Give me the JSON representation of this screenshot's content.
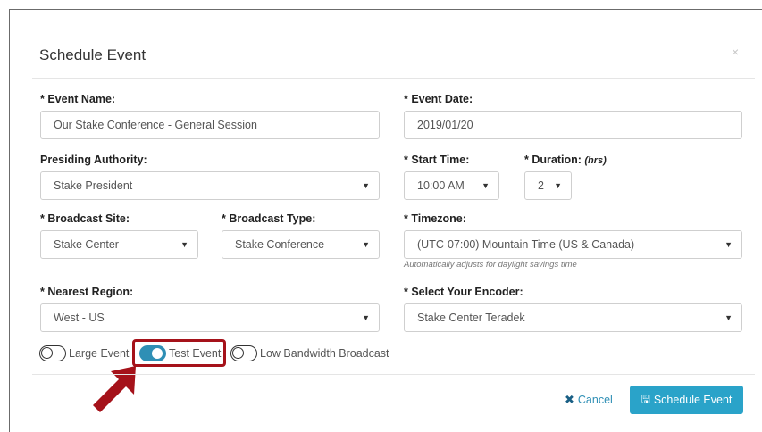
{
  "modal": {
    "title": "Schedule Event",
    "close_icon": "×"
  },
  "form": {
    "event_name": {
      "label": "* Event Name:",
      "value": "Our Stake Conference - General Session"
    },
    "event_date": {
      "label": "* Event Date:",
      "value": "2019/01/20"
    },
    "presiding_authority": {
      "label": "Presiding Authority:",
      "value": "Stake President"
    },
    "start_time": {
      "label": "* Start Time:",
      "value": "10:00 AM"
    },
    "duration": {
      "label": "* Duration:",
      "unit": "(hrs)",
      "value": "2"
    },
    "broadcast_site": {
      "label": "* Broadcast Site:",
      "value": "Stake Center"
    },
    "broadcast_type": {
      "label": "* Broadcast Type:",
      "value": "Stake Conference"
    },
    "timezone": {
      "label": "* Timezone:",
      "value": "(UTC-07:00) Mountain Time (US & Canada)",
      "help": "Automatically adjusts for daylight savings time"
    },
    "nearest_region": {
      "label": "* Nearest Region:",
      "value": "West - US"
    },
    "encoder": {
      "label": "* Select Your Encoder:",
      "value": "Stake Center Teradek"
    }
  },
  "toggles": {
    "large_event": {
      "label": "Large Event",
      "on": false
    },
    "test_event": {
      "label": "Test Event",
      "on": true
    },
    "low_bandwidth": {
      "label": "Low Bandwidth Broadcast",
      "on": false
    }
  },
  "footer": {
    "cancel_label": "Cancel",
    "schedule_label": "Schedule Event"
  },
  "colors": {
    "accent": "#2aa3c9",
    "toggle_on": "#2f8fb5",
    "highlight": "#a5121a"
  },
  "icons": {
    "caret": "caret-down-icon",
    "close": "close-icon",
    "cancel": "x-icon",
    "save": "save-icon",
    "annotation": "arrow-icon"
  }
}
